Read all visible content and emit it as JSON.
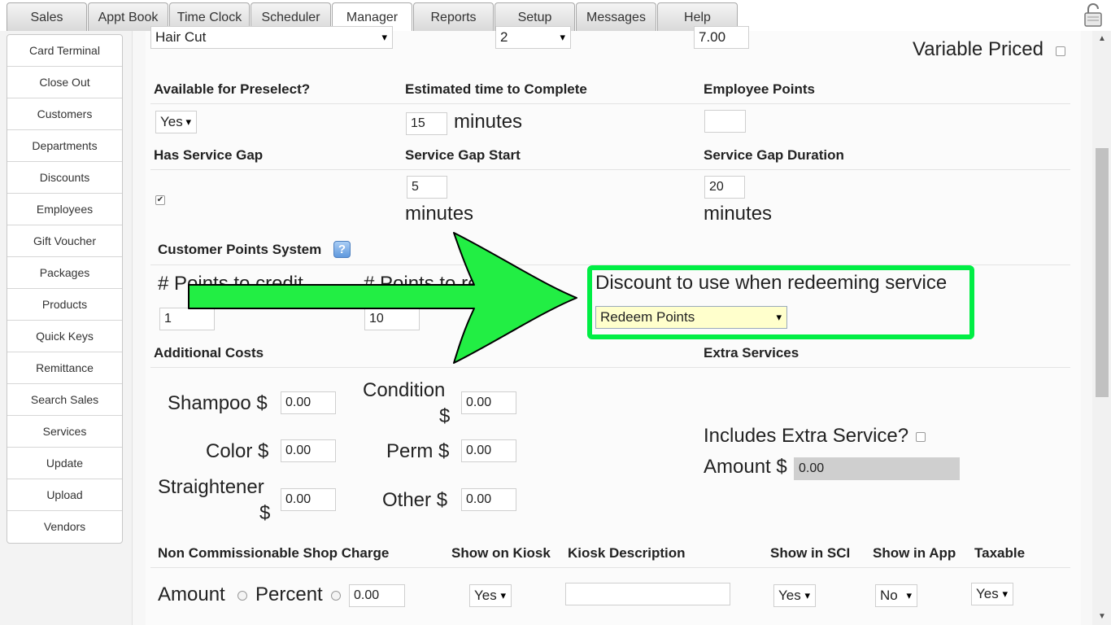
{
  "tabs": [
    {
      "label": "Sales"
    },
    {
      "label": "Appt Book"
    },
    {
      "label": "Time Clock"
    },
    {
      "label": "Scheduler"
    },
    {
      "label": "Manager"
    },
    {
      "label": "Reports"
    },
    {
      "label": "Setup"
    },
    {
      "label": "Messages"
    },
    {
      "label": "Help"
    }
  ],
  "sidebar": {
    "items": [
      {
        "label": "Card Terminal"
      },
      {
        "label": "Close Out"
      },
      {
        "label": "Customers"
      },
      {
        "label": "Departments"
      },
      {
        "label": "Discounts"
      },
      {
        "label": "Employees"
      },
      {
        "label": "Gift Voucher"
      },
      {
        "label": "Packages"
      },
      {
        "label": "Products"
      },
      {
        "label": "Quick Keys"
      },
      {
        "label": "Remittance"
      },
      {
        "label": "Search Sales"
      },
      {
        "label": "Services"
      },
      {
        "label": "Update"
      },
      {
        "label": "Upload"
      },
      {
        "label": "Vendors"
      }
    ]
  },
  "top": {
    "service_select": "Hair Cut",
    "qty_select": "2",
    "price_value": "7.00",
    "variable_priced_label": "Variable Priced"
  },
  "preselect": {
    "label": "Available for Preselect?",
    "value": "Yes"
  },
  "estimated": {
    "label": "Estimated time to Complete",
    "value": "15",
    "unit": "minutes"
  },
  "employee_points": {
    "label": "Employee Points",
    "value": ""
  },
  "service_gap": {
    "has_label": "Has Service Gap",
    "start_label": "Service Gap Start",
    "start_value": "5",
    "start_unit": "minutes",
    "duration_label": "Service Gap Duration",
    "duration_value": "20",
    "duration_unit": "minutes"
  },
  "points": {
    "section_label": "Customer Points System",
    "help": "?",
    "credit_label": "# Points to credit",
    "credit_value": "1",
    "redeem_label": "# Points to redeem",
    "redeem_value": "10",
    "discount_label": "Discount to use when redeeming service",
    "discount_value": "Redeem Points"
  },
  "additional": {
    "label": "Additional Costs",
    "shampoo_label": "Shampoo $",
    "shampoo_value": "0.00",
    "condition_label": "Condition",
    "condition_dollar": "$",
    "condition_value": "0.00",
    "color_label": "Color $",
    "color_value": "0.00",
    "perm_label": "Perm $",
    "perm_value": "0.00",
    "straightener_label": "Straightener",
    "straightener_dollar": "$",
    "straightener_value": "0.00",
    "other_label": "Other $",
    "other_value": "0.00"
  },
  "extra": {
    "label": "Extra Services",
    "includes_label": "Includes Extra Service?",
    "amount_label": "Amount $",
    "amount_value": "0.00"
  },
  "bottom": {
    "shop_charge_label": "Non Commissionable Shop Charge",
    "kiosk_label": "Show on Kiosk",
    "kiosk_desc_label": "Kiosk Description",
    "sci_label": "Show in SCI",
    "app_label": "Show in App",
    "taxable_label": "Taxable",
    "amount_label": "Amount",
    "percent_label": "Percent",
    "charge_value": "0.00",
    "kiosk_value": "Yes",
    "kiosk_desc_value": "",
    "sci_value": "Yes",
    "app_value": "No",
    "taxable_value": "Yes"
  },
  "colors": {
    "highlight": "#00ee44",
    "arrow": "#22ee44",
    "select_highlight": "#ffffcc"
  }
}
